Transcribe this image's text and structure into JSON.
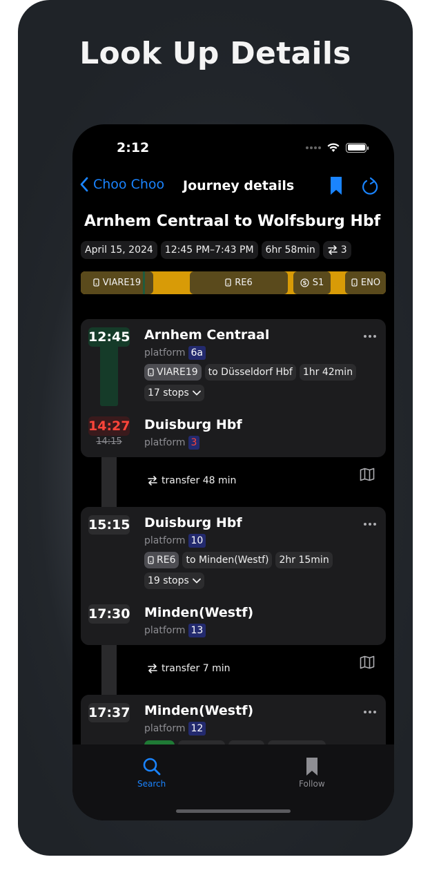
{
  "headline": "Look Up Details",
  "status": {
    "time": "2:12"
  },
  "nav": {
    "back_label": "Choo Choo",
    "title": "Journey details"
  },
  "journey": {
    "title": "Arnhem Centraal to Wolfsburg Hbf",
    "date": "April 15, 2024",
    "time_range": "12:45 PM–7:43 PM",
    "duration": "6hr 58min",
    "transfers": "3"
  },
  "segments": [
    {
      "label": "VIARE19",
      "icon": "train-icon"
    },
    {
      "label": "RE6",
      "icon": "train-icon"
    },
    {
      "label": "S1",
      "icon": "s-bahn-icon"
    },
    {
      "label": "ENO",
      "icon": "train-icon"
    }
  ],
  "legs": [
    {
      "dep_time": "12:45",
      "dep_stop": "Arnhem Centraal",
      "dep_platform": "6a",
      "train": "VIARE19",
      "direction": "to Düsseldorf Hbf",
      "duration": "1hr 42min",
      "stops": "17 stops",
      "arr_time": "14:27",
      "arr_time_planned": "14:15",
      "arr_stop": "Duisburg Hbf",
      "arr_platform": "3"
    },
    {
      "dep_time": "15:15",
      "dep_stop": "Duisburg Hbf",
      "dep_platform": "10",
      "train": "RE6",
      "direction": "to Minden(Westf)",
      "duration": "2hr 15min",
      "stops": "19 stops",
      "arr_time": "17:30",
      "arr_stop": "Minden(Westf)",
      "arr_platform": "13"
    },
    {
      "dep_time": "17:37",
      "dep_stop": "Minden(Westf)",
      "dep_platform": "12"
    }
  ],
  "transfers": [
    {
      "label": "transfer 48 min"
    },
    {
      "label": "transfer 7 min"
    }
  ],
  "labels": {
    "platform": "platform"
  },
  "tabs": [
    {
      "label": "Search",
      "icon": "magnifier-icon",
      "active": true
    },
    {
      "label": "Follow",
      "icon": "bookmark-icon",
      "active": false
    }
  ],
  "colors": {
    "accent": "#1a84ff",
    "timeline": "#d89b07",
    "delay": "#ff453a",
    "platform_badge": "#232a6e",
    "on_time_green": "#153b29"
  }
}
